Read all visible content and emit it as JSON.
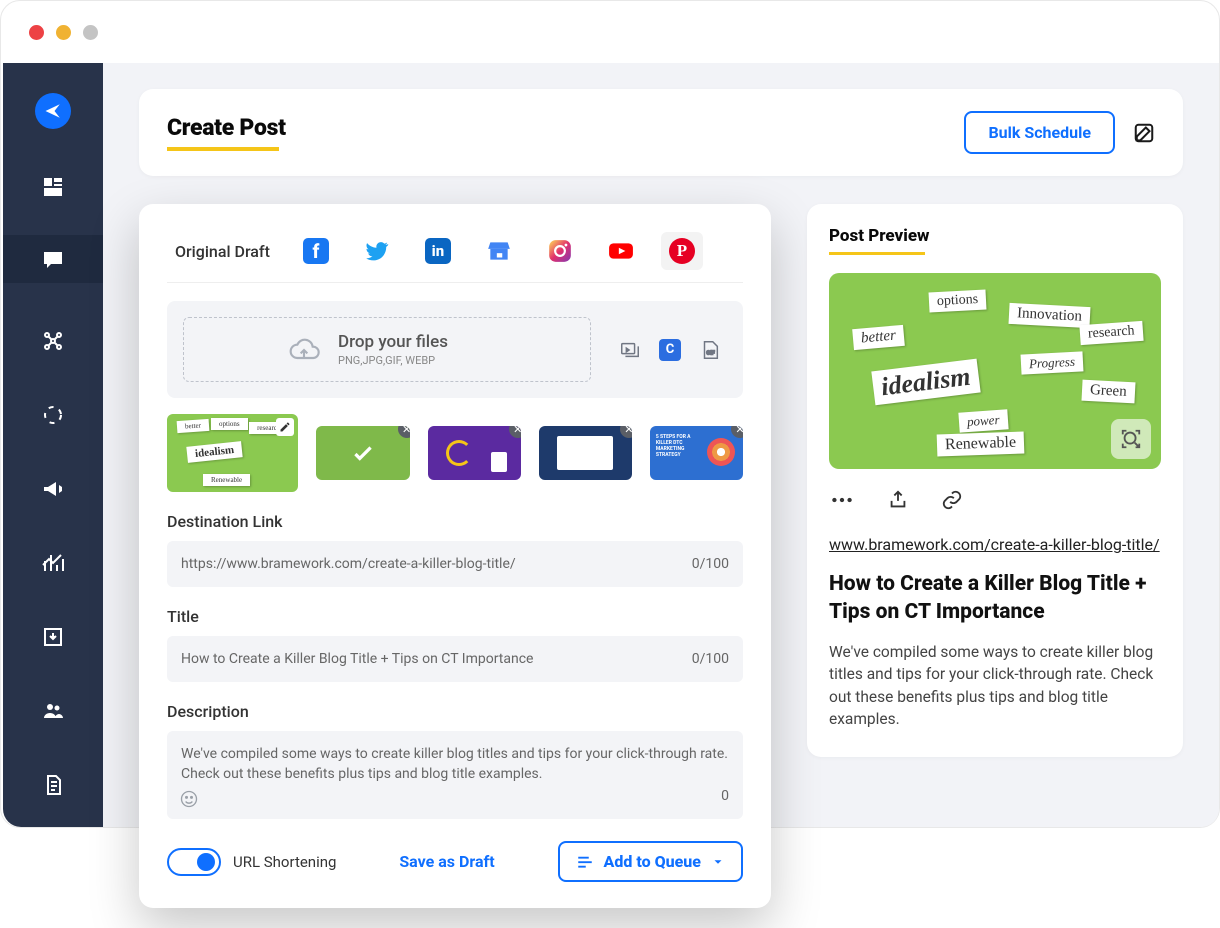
{
  "header": {
    "title": "Create Post",
    "bulk_schedule": "Bulk Schedule"
  },
  "compose": {
    "original_draft": "Original Draft",
    "dropzone_title": "Drop your files",
    "dropzone_sub": "PNG,JPG,GIF, WEBP",
    "destination_link_label": "Destination Link",
    "destination_link_value": "https://www.bramework.com/create-a-killer-blog-title/",
    "destination_link_counter": "0/100",
    "title_label": "Title",
    "title_value": "How to Create a Killer Blog Title + Tips on CT Importance",
    "title_counter": "0/100",
    "description_label": "Description",
    "description_value": "We've compiled some ways to create killer blog titles and tips for your click-through rate. Check out these benefits plus tips and blog title examples.",
    "description_counter": "0",
    "url_shortening_label": "URL Shortening",
    "save_as_draft": "Save as Draft",
    "add_to_queue": "Add to Queue",
    "canva_letter": "C"
  },
  "preview": {
    "heading": "Post Preview",
    "url": "www.bramework.com/create-a-killer-blog-title/",
    "title": "How to Create a Killer Blog Title + Tips on CT Importance",
    "description": "We've compiled some ways to create killer blog titles and tips for your click-through rate. Check out these benefits plus tips and blog title examples.",
    "words": [
      "options",
      "Innovation",
      "research",
      "better",
      "idealism",
      "Progress",
      "Green",
      "power",
      "Renewable"
    ]
  }
}
